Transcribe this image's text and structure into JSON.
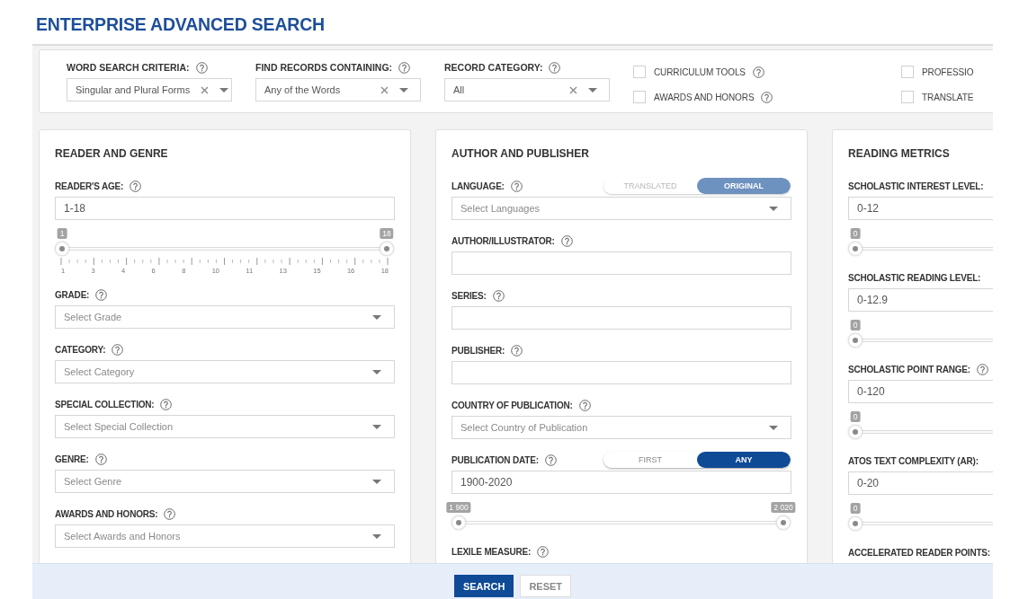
{
  "title": "ENTERPRISE ADVANCED SEARCH",
  "filters": [
    {
      "kind": "select",
      "label": "WORD SEARCH CRITERIA:",
      "help": true,
      "value": "Singular and Plural Forms",
      "clearable": true
    },
    {
      "kind": "select",
      "label": "FIND RECORDS CONTAINING:",
      "help": true,
      "value": "Any of the Words",
      "clearable": true
    },
    {
      "kind": "select",
      "label": "RECORD CATEGORY:",
      "help": true,
      "value": "All",
      "clearable": true
    }
  ],
  "checkboxes": [
    {
      "label": "CURRICULUM TOOLS",
      "checked": false,
      "help": true
    },
    {
      "label": "AWARDS AND HONORS",
      "checked": false,
      "help": true
    },
    {
      "label": "PROFESSIO",
      "checked": false,
      "help": false
    },
    {
      "label": "TRANSLATE",
      "checked": false,
      "help": false
    }
  ],
  "panels": [
    {
      "title": "READER AND GENRE",
      "fields": [
        {
          "kind": "range",
          "label": "READER'S AGE:",
          "help": true,
          "value": "1-18",
          "thumbs": [
            {
              "label": "1",
              "level": 0
            },
            {
              "label": "18",
              "level": 1
            }
          ],
          "ticks": [
            "1",
            "3",
            "4",
            "6",
            "8",
            "10",
            "11",
            "13",
            "15",
            "16",
            "18"
          ]
        },
        {
          "kind": "select",
          "label": "GRADE:",
          "help": true,
          "placeholder": "Select Grade"
        },
        {
          "kind": "select",
          "label": "CATEGORY:",
          "help": true,
          "placeholder": "Select Category"
        },
        {
          "kind": "select",
          "label": "SPECIAL COLLECTION:",
          "help": true,
          "placeholder": "Select Special Collection"
        },
        {
          "kind": "select",
          "label": "GENRE:",
          "help": true,
          "placeholder": "Select Genre"
        },
        {
          "kind": "select",
          "label": "AWARDS AND HONORS:",
          "help": true,
          "placeholder": "Select Awards and Honors"
        }
      ]
    },
    {
      "title": "AUTHOR AND PUBLISHER",
      "fields": [
        {
          "kind": "select",
          "label": "LANGUAGE:",
          "help": true,
          "placeholder": "Select Languages",
          "toggle": {
            "disabled": true,
            "options": [
              {
                "label": "TRANSLATED",
                "selected": false
              },
              {
                "label": "ORIGINAL",
                "selected": true
              }
            ]
          }
        },
        {
          "kind": "input",
          "label": "AUTHOR/ILLUSTRATOR:",
          "help": true
        },
        {
          "kind": "input",
          "label": "SERIES:",
          "help": true
        },
        {
          "kind": "input",
          "label": "PUBLISHER:",
          "help": true
        },
        {
          "kind": "select",
          "label": "COUNTRY OF PUBLICATION:",
          "help": true,
          "placeholder": "Select Country of Publication"
        },
        {
          "kind": "range",
          "label": "PUBLICATION DATE:",
          "help": true,
          "value": "1900-2020",
          "thumbs": [
            {
              "label": "1 900",
              "level": 0
            },
            {
              "label": "2 020",
              "level": 1
            }
          ],
          "toggle": {
            "disabled": false,
            "options": [
              {
                "label": "FIRST",
                "selected": false
              },
              {
                "label": "ANY",
                "selected": true
              }
            ]
          }
        },
        {
          "kind": "label",
          "label": "LEXILE MEASURE:",
          "help": true
        }
      ]
    },
    {
      "title": "READING METRICS",
      "fields": [
        {
          "kind": "range",
          "label": "SCHOLASTIC INTEREST LEVEL:",
          "help": false,
          "value": "0-12",
          "thumbs": [
            {
              "label": "0",
              "level": 0
            }
          ]
        },
        {
          "kind": "range",
          "label": "SCHOLASTIC READING LEVEL:",
          "help": false,
          "value": "0-12.9",
          "thumbs": [
            {
              "label": "0",
              "level": 0
            }
          ]
        },
        {
          "kind": "range",
          "label": "SCHOLASTIC POINT RANGE:",
          "help": true,
          "value": "0-120",
          "thumbs": [
            {
              "label": "0",
              "level": 0
            }
          ]
        },
        {
          "kind": "range",
          "label": "ATOS TEXT COMPLEXITY (AR):",
          "help": false,
          "value": "0-20",
          "thumbs": [
            {
              "label": "0",
              "level": 0
            }
          ]
        },
        {
          "kind": "label",
          "label": "ACCELERATED READER POINTS:",
          "help": false
        }
      ]
    }
  ],
  "buttons": [
    {
      "label": "SEARCH",
      "kind": "primary"
    },
    {
      "label": "RESET",
      "kind": "secondary"
    }
  ]
}
